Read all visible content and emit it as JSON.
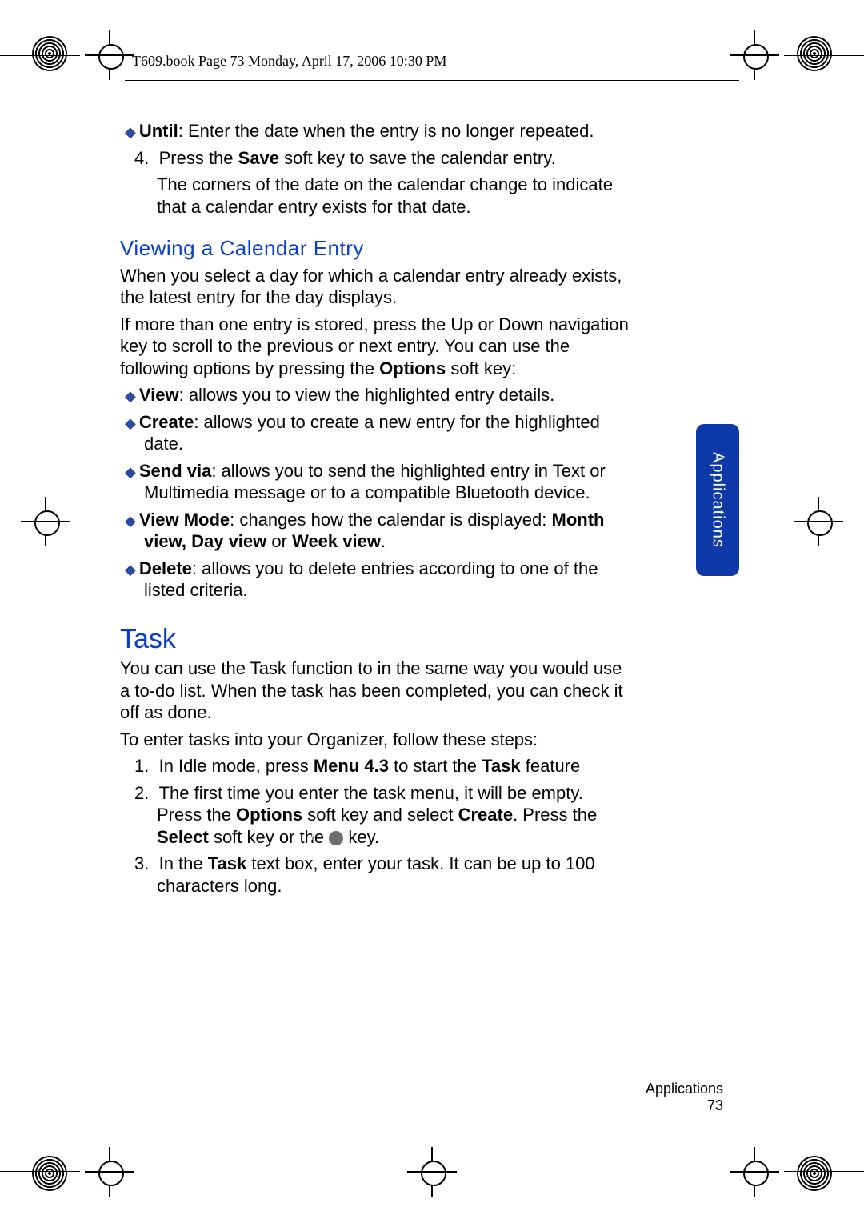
{
  "header": "T609.book  Page 73  Monday, April 17, 2006  10:30 PM",
  "until_line": {
    "bold": "Until",
    "rest": ": Enter the date when the entry is no longer repeated."
  },
  "step4_a": "Press the ",
  "step4_b": "Save",
  "step4_c": " soft key to save the calendar entry.",
  "step4_para": "The corners of the date on the calendar change to indicate that a calendar entry exists for that date.",
  "sec_view_title": "Viewing a Calendar Entry",
  "view_p1": "When you select a day for which a calendar entry already exists, the latest entry for the day displays.",
  "view_p2_a": "If more than one entry is stored, press the Up or Down navigation key to scroll to the previous or next entry. You can use the following options by pressing the ",
  "view_p2_b": "Options",
  "view_p2_c": " soft key:",
  "opts": [
    {
      "b": "View",
      "t": ": allows you to view the highlighted entry details."
    },
    {
      "b": "Create",
      "t": ": allows you to create a new entry for the highlighted date."
    },
    {
      "b": "Send via",
      "t": ": allows you to send the highlighted entry in Text or Multimedia message or to a compatible Bluetooth device."
    },
    {
      "b": "View Mode",
      "t": ": changes how the calendar is displayed: ",
      "b2": "Month view, Day view",
      "mid": " or ",
      "b3": "Week view",
      "end": "."
    },
    {
      "b": "Delete",
      "t": ": allows you to delete entries according to one of the listed criteria."
    }
  ],
  "task_title": "Task",
  "task_p1": "You can use the Task function to in the same way you would use a to-do list. When the task has been completed, you can check it off as done.",
  "task_p2": "To enter tasks into your Organizer, follow these steps:",
  "task_steps": {
    "s1_a": "In Idle mode, press ",
    "s1_b": "Menu 4.3",
    "s1_c": " to start the ",
    "s1_d": "Task",
    "s1_e": " feature",
    "s2_a": "The first time you enter the task menu, it will be empty. Press the ",
    "s2_b": "Options",
    "s2_c": " soft key and select ",
    "s2_d": "Create",
    "s2_e": ". Press the ",
    "s2_f": "Select",
    "s2_g": " soft key or the ",
    "s2_h": " key.",
    "s3_a": "In the ",
    "s3_b": "Task",
    "s3_c": " text box, enter your task. It can be up to 100 characters long."
  },
  "tab_label": "Applications",
  "footer_section": "Applications",
  "footer_page": "73",
  "numbers": {
    "four": "4.",
    "one": "1.",
    "two": "2.",
    "three": "3."
  }
}
